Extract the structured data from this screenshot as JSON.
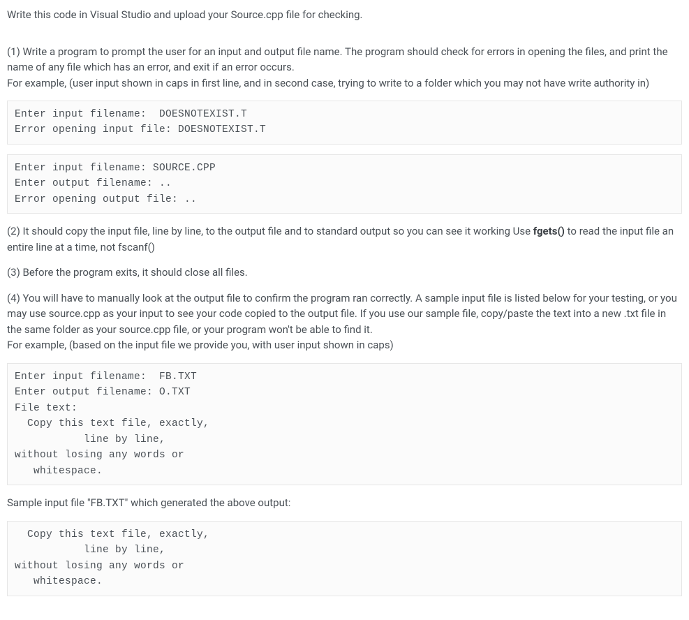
{
  "intro": "Write this code in Visual Studio and upload your Source.cpp file for checking.",
  "part1_a": "(1) Write a program to prompt the user for an input and output file name. The program should check for errors in opening the files, and print the name of any file which has an error, and exit if an error occurs.",
  "part1_b": "For example, (user input shown in caps in first line, and in second case, trying to write to a folder which you may not have write authority in)",
  "code1": "Enter input filename:  DOESNOTEXIST.T\nError opening input file: DOESNOTEXIST.T",
  "code2": "Enter input filename: SOURCE.CPP\nEnter output filename: ..\nError opening output file: ..",
  "part2_prefix": "(2) It should copy the input file, line by line, to the output file and to standard output so you can see it working Use ",
  "part2_bold": "fgets()",
  "part2_suffix": " to read the input file an entire line at a time, not fscanf()",
  "part3": "(3) Before the program exits, it should close all files.",
  "part4_a": "(4) You will have to manually look at the output file to confirm the program ran correctly. A sample input file is listed below for your testing, or you may use source.cpp as your input to see your code copied to the output file. If you use our sample file, copy/paste the text into a new .txt file in the same folder as your source.cpp file, or your program won't be able to find it.",
  "part4_b": "For example, (based on the input file we provide you, with user input shown in caps)",
  "code3": "Enter input filename:  FB.TXT\nEnter output filename: O.TXT\nFile text:\n  Copy this text file, exactly,\n           line by line,\nwithout losing any words or\n   whitespace.",
  "sample_label": "Sample input file \"FB.TXT\" which generated the above output:",
  "code4": "  Copy this text file, exactly,\n           line by line,\nwithout losing any words or\n   whitespace."
}
